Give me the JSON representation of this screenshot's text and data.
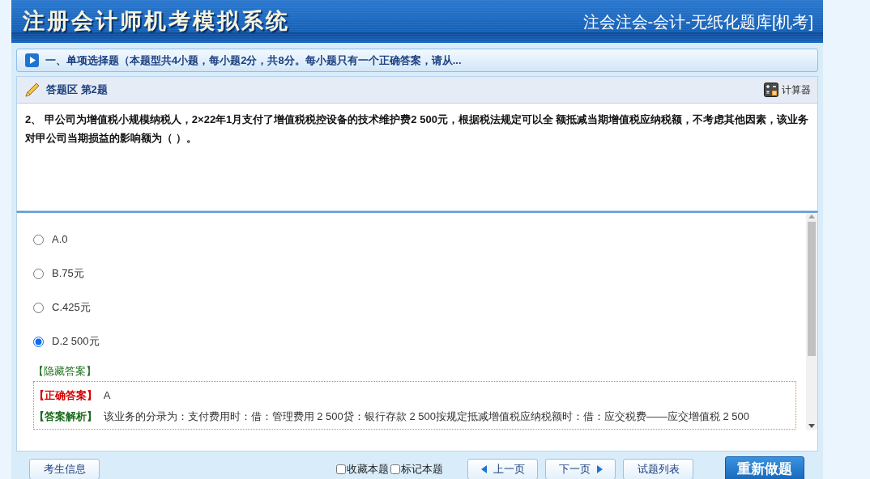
{
  "header": {
    "title": "注册会计师机考模拟系统",
    "subtitle": "注会注会-会计-无纸化题库[机考]"
  },
  "section": {
    "title": "一、单项选择题（本题型共4小题，每小题2分，共8分。每小题只有一个正确答案，请从..."
  },
  "answer_zone": {
    "title": "答题区 第2题",
    "calculator": "计算器"
  },
  "question": {
    "text": "2、 甲公司为增值税小规模纳税人，2×22年1月支付了增值税税控设备的技术维护费2 500元，根据税法规定可以全 额抵减当期增值税应纳税额，不考虑其他因素，该业务对甲公司当期损益的影响额为（ ）。"
  },
  "options": [
    {
      "label": "A.0",
      "selected": false
    },
    {
      "label": "B.75元",
      "selected": false
    },
    {
      "label": "C.425元",
      "selected": false
    },
    {
      "label": "D.2 500元",
      "selected": true
    }
  ],
  "answer": {
    "toggle": "【隐藏答案】",
    "correct_label": "【正确答案】",
    "correct_value": "A",
    "analysis_label": "【答案解析】",
    "analysis": "该业务的分录为：支付费用时：借：管理费用 2 500贷：银行存款 2 500按规定抵减增值税应纳税额时：借：应交税费——应交增值税 2 500"
  },
  "footer": {
    "info_button": "考生信息",
    "checkboxes": [
      {
        "label": "收藏本题",
        "checked": false
      },
      {
        "label": "标记本题",
        "checked": false
      }
    ],
    "buttons": [
      {
        "label": "上一页",
        "kind": "prev"
      },
      {
        "label": "下一页",
        "kind": "next"
      },
      {
        "label": "试题列表",
        "kind": "plain"
      },
      {
        "label": "重新做题",
        "kind": "primary"
      }
    ]
  }
}
